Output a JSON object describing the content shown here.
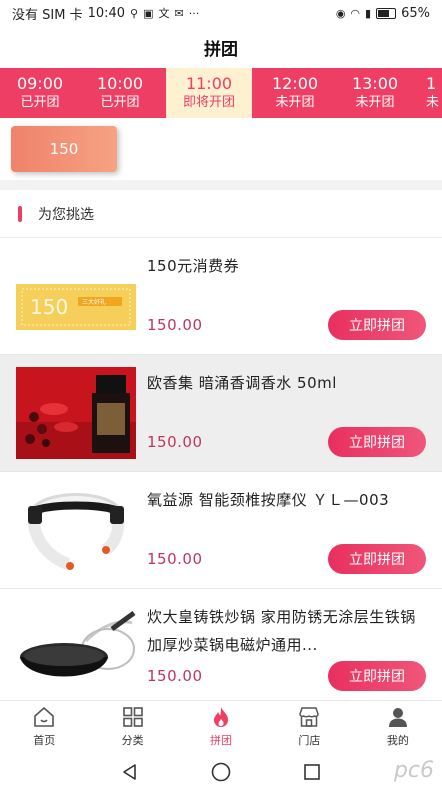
{
  "status_bar": {
    "carrier": "没有 SIM 卡",
    "time": "10:40",
    "battery": "65%"
  },
  "header": {
    "title": "拼团"
  },
  "time_tabs": [
    {
      "time": "09:00",
      "status": "已开团"
    },
    {
      "time": "10:00",
      "status": "已开团"
    },
    {
      "time": "11:00",
      "status": "即将开团",
      "active": true
    },
    {
      "time": "12:00",
      "status": "未开团"
    },
    {
      "time": "13:00",
      "status": "未开团"
    },
    {
      "time": "1",
      "status": "未"
    }
  ],
  "amount_chip": "150",
  "section": {
    "title": "为您挑选"
  },
  "products": [
    {
      "name": "150元消费券",
      "price": "150.00",
      "button": "立即拼团",
      "image": "voucher",
      "voucher_text": "150",
      "voucher_tag": "三大好礼"
    },
    {
      "name": "欧香集 暗涌香调香水 50ml",
      "price": "150.00",
      "button": "立即拼团",
      "image": "perfume"
    },
    {
      "name": "氧益源 智能颈椎按摩仪 ＹＬ—003",
      "price": "150.00",
      "button": "立即拼团",
      "image": "neck-massager"
    },
    {
      "name": "炊大皇铸铁炒锅 家用防锈无涂层生铁锅加厚炒菜锅电磁炉通用...",
      "price": "150.00",
      "button": "立即拼团",
      "image": "wok"
    }
  ],
  "bottom_nav": [
    {
      "label": "首页",
      "icon": "home-icon"
    },
    {
      "label": "分类",
      "icon": "grid-icon"
    },
    {
      "label": "拼团",
      "icon": "flame-icon",
      "active": true
    },
    {
      "label": "门店",
      "icon": "store-icon"
    },
    {
      "label": "我的",
      "icon": "user-icon"
    }
  ],
  "watermark": "pc6",
  "colors": {
    "accent": "#ee3e63",
    "active_tab_bg": "#fdf1d2",
    "price": "#c0355f"
  }
}
